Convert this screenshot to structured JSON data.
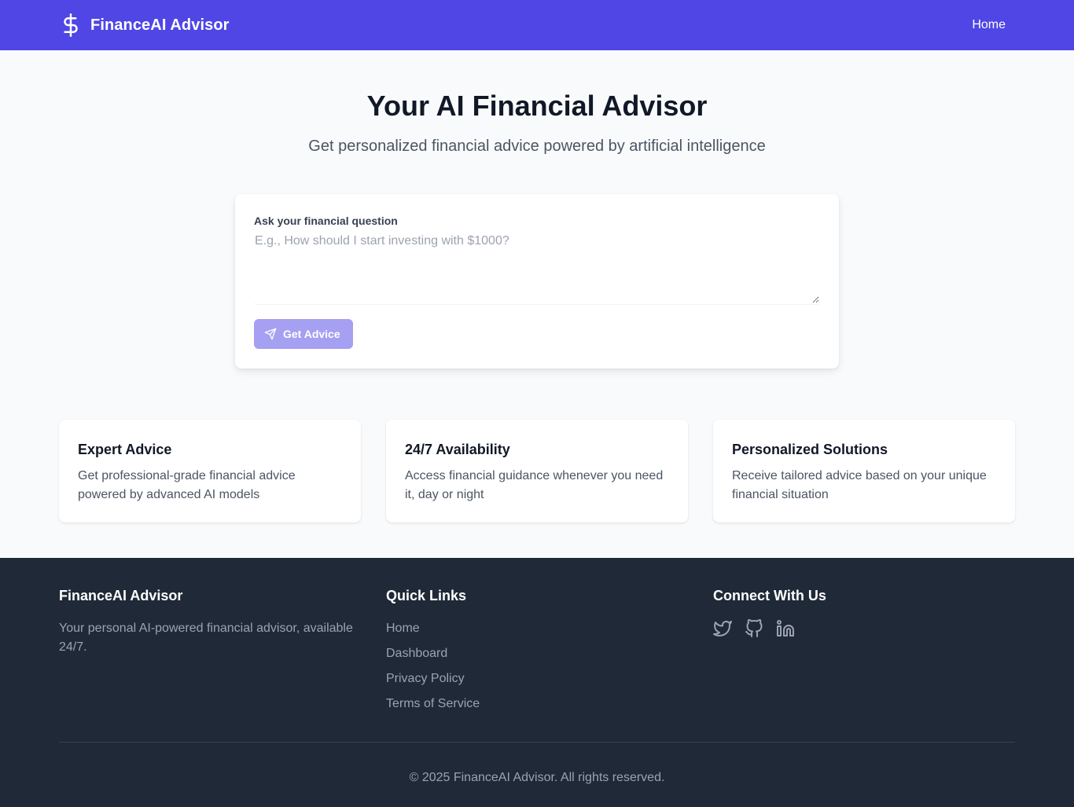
{
  "header": {
    "brand_icon": "dollar-sign-icon",
    "brand_name": "FinanceAI Advisor",
    "nav_home": "Home"
  },
  "hero": {
    "title": "Your AI Financial Advisor",
    "subtitle": "Get personalized financial advice powered by artificial intelligence"
  },
  "question_form": {
    "label": "Ask your financial question",
    "placeholder": "E.g., How should I start investing with $1000?",
    "value": "",
    "button_label": "Get Advice",
    "button_icon": "send-icon"
  },
  "features": [
    {
      "title": "Expert Advice",
      "description": "Get professional-grade financial advice powered by advanced AI models"
    },
    {
      "title": "24/7 Availability",
      "description": "Access financial guidance whenever you need it, day or night"
    },
    {
      "title": "Personalized Solutions",
      "description": "Receive tailored advice based on your unique financial situation"
    }
  ],
  "footer": {
    "about_heading": "FinanceAI Advisor",
    "about_text": "Your personal AI-powered financial advisor, available 24/7.",
    "links_heading": "Quick Links",
    "links": [
      "Home",
      "Dashboard",
      "Privacy Policy",
      "Terms of Service"
    ],
    "connect_heading": "Connect With Us",
    "social_icons": [
      "twitter-icon",
      "github-icon",
      "linkedin-icon"
    ],
    "copyright": "© 2025 FinanceAI Advisor. All rights reserved."
  },
  "colors": {
    "primary": "#4f46e5",
    "button_disabled": "#a5a0f2",
    "footer_bg": "#1f2937",
    "page_bg": "#f9fafb"
  }
}
